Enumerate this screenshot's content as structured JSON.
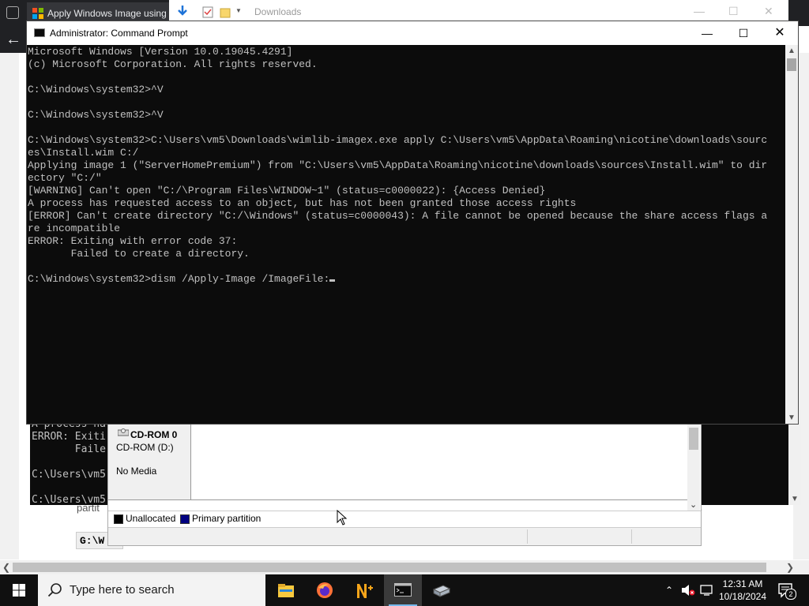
{
  "browser": {
    "tab_title": "Apply Windows Image using",
    "page_fragment": "partit",
    "page_code": "G:\\W",
    "paren_fragment": "."
  },
  "explorer": {
    "title": "Downloads"
  },
  "background_console": {
    "lines": "A process ha\nERROR: Exiti\n       Faile\n\nC:\\Users\\vm5\n\nC:\\Users\\vm5"
  },
  "disk_management": {
    "disk_label": "CD-ROM 0",
    "disk_type": "CD-ROM (D:)",
    "disk_media": "No Media",
    "legend": [
      {
        "label": "Unallocated",
        "color": "#000000"
      },
      {
        "label": "Primary partition",
        "color": "#000080"
      }
    ]
  },
  "cmd": {
    "title": "Administrator: Command Prompt",
    "output": "Microsoft Windows [Version 10.0.19045.4291]\n(c) Microsoft Corporation. All rights reserved.\n\nC:\\Windows\\system32>^V\n\nC:\\Windows\\system32>^V\n\nC:\\Windows\\system32>C:\\Users\\vm5\\Downloads\\wimlib-imagex.exe apply C:\\Users\\vm5\\AppData\\Roaming\\nicotine\\downloads\\sourc\nes\\Install.wim C:/\nApplying image 1 (\"ServerHomePremium\") from \"C:\\Users\\vm5\\AppData\\Roaming\\nicotine\\downloads\\sources\\Install.wim\" to dir\nectory \"C:/\"\n[WARNING] Can't open \"C:/\\Program Files\\WINDOW~1\" (status=c0000022): {Access Denied}\nA process has requested access to an object, but has not been granted those access rights\n[ERROR] Can't create directory \"C:/\\Windows\" (status=c0000043): A file cannot be opened because the share access flags a\nre incompatible\nERROR: Exiting with error code 37:\n       Failed to create a directory.\n\n",
    "prompt": "C:\\Windows\\system32>dism /Apply-Image /ImageFile:"
  },
  "taskbar": {
    "search_placeholder": "Type here to search",
    "apps": [
      "file-explorer",
      "firefox",
      "notepad-plus-plus",
      "command-prompt",
      "tool-app"
    ],
    "time": "12:31 AM",
    "date": "10/18/2024",
    "notification_count": "2",
    "accent_color": "#76b9ed"
  }
}
